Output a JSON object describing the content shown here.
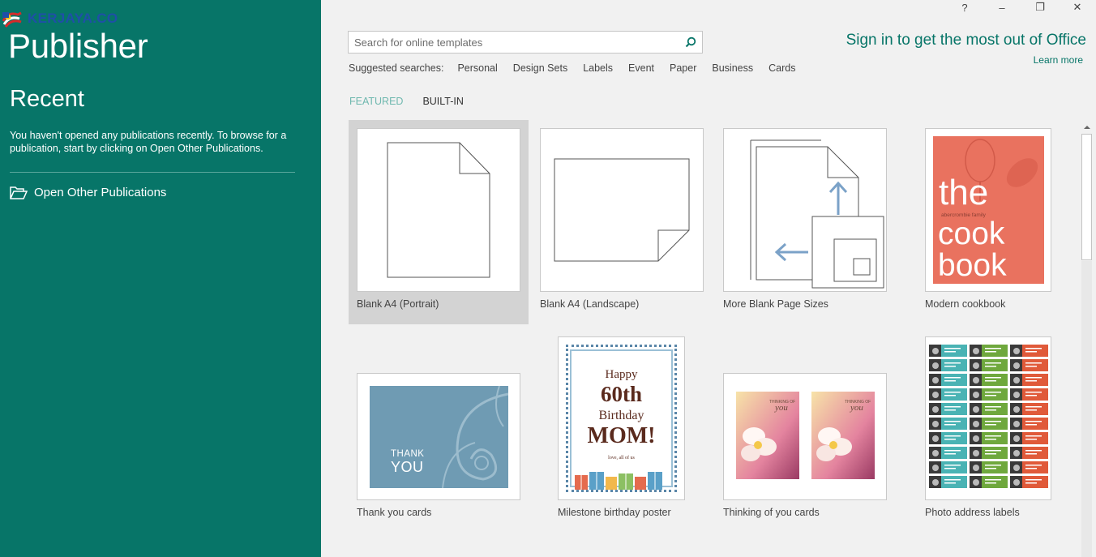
{
  "app": {
    "watermark": "KERJAYA.CO",
    "title": "Publisher"
  },
  "window_controls": {
    "help": "?",
    "minimize": "–",
    "restore": "❐",
    "close": "✕"
  },
  "sidebar": {
    "recent_title": "Recent",
    "recent_message": "You haven't opened any publications recently. To browse for a publication, start by clicking on Open Other Publications.",
    "open_other_label": "Open Other Publications"
  },
  "search": {
    "placeholder": "Search for online templates",
    "value": ""
  },
  "suggested": {
    "label": "Suggested searches:",
    "items": [
      "Personal",
      "Design Sets",
      "Labels",
      "Event",
      "Paper",
      "Business",
      "Cards"
    ]
  },
  "account": {
    "signin_text": "Sign in to get the most out of Office",
    "learn_more": "Learn more"
  },
  "tabs": {
    "featured": "FEATURED",
    "builtin": "BUILT-IN"
  },
  "templates": [
    {
      "caption": "Blank A4 (Portrait)",
      "selected": true
    },
    {
      "caption": "Blank A4 (Landscape)"
    },
    {
      "caption": "More Blank Page Sizes"
    },
    {
      "caption": "Modern cookbook"
    },
    {
      "caption": "Thank you cards"
    },
    {
      "caption": "Milestone birthday poster"
    },
    {
      "caption": "Thinking of you cards"
    },
    {
      "caption": "Photo address labels"
    }
  ],
  "thumb_text": {
    "cookbook": {
      "the": "the",
      "sub": "abercrombie family",
      "cook": "cook",
      "book": "book"
    },
    "thankyou": {
      "line1": "THANK",
      "line2": "YOU"
    },
    "birthday": {
      "happy": "Happy",
      "age": "60th",
      "birthday": "Birthday",
      "mom": "MOM!",
      "sign": "love, all of us"
    },
    "thinking": {
      "line1": "THINKING OF",
      "line2": "you"
    }
  },
  "colors": {
    "sidebar": "#077568",
    "accent": "#077568",
    "featured_tab": "#6fb8af",
    "cookbook": "#e9725f",
    "thankyou": "#6f9bb3"
  }
}
